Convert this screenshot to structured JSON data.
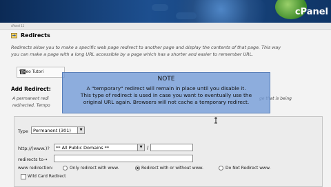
{
  "header": {
    "logo_text": "cPanel",
    "breadcrumb": "cPanel 11"
  },
  "page": {
    "title": "Redirects",
    "description_line1": "Redirects allow you to make a specific web page redirect to another page and display the contents of that page. This way",
    "description_line2": "you can make a page with a long URL accessible by a page which has a shorter and easier to remember URL."
  },
  "video_tab": {
    "label": "Video Tutori"
  },
  "add_redirect": {
    "heading": "Add Redirect:",
    "permanent_line": "A permanent redi",
    "redirected_line": "redirected. Tempo",
    "page_being": "ge that is being"
  },
  "form": {
    "type_label": "Type",
    "type_value": "Permanent (301)",
    "http_label": "http://(www.)?",
    "domain_value": "** All Public Domains **",
    "slash": "/",
    "path_value": "",
    "redirects_to_label": "redirects to→",
    "redirects_to_value": "",
    "www_label": "www redirection:",
    "www_options": [
      "Only redirect with www.",
      "Redirect with or without www.",
      "Do Not Redirect www."
    ],
    "www_selected": 1,
    "wildcard_label": "Wild Card Redirect"
  },
  "note": {
    "title": "NOTE",
    "line1": "A \"temporary\" redirect will remain in place until you disable it.",
    "line2": "This type of redirect is used in case you want to eventually use the",
    "line3": "original URL again. Browsers will not cache a temporary redirect."
  },
  "colors": {
    "header_bg": "#1d4f8f",
    "note_bg": "#769ed8",
    "page_bg": "#f3f3f3"
  },
  "icons": [
    "redirect-icon",
    "video-icon",
    "mouse-cursor-icon",
    "dropdown-arrow-icon"
  ]
}
